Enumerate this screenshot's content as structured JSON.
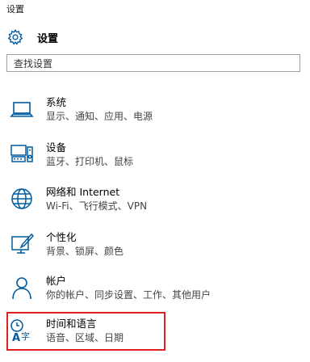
{
  "window": {
    "title": "设置"
  },
  "header": {
    "title": "设置",
    "icon": "gear-icon"
  },
  "search": {
    "placeholder": "查找设置"
  },
  "categories": [
    {
      "icon": "laptop-icon",
      "name": "系统",
      "desc": "显示、通知、应用、电源"
    },
    {
      "icon": "devices-icon",
      "name": "设备",
      "desc": "蓝牙、打印机、鼠标"
    },
    {
      "icon": "globe-icon",
      "name": "网络和 Internet",
      "desc": "Wi-Fi、飞行模式、VPN"
    },
    {
      "icon": "personalization-icon",
      "name": "个性化",
      "desc": "背景、锁屏、颜色"
    },
    {
      "icon": "person-icon",
      "name": "帐户",
      "desc": "你的帐户、同步设置、工作、其他用户"
    },
    {
      "icon": "time-language-icon",
      "name": "时间和语言",
      "desc": "语音、区域、日期"
    }
  ],
  "colors": {
    "accent": "#005a9e",
    "highlight": "#e02020"
  }
}
